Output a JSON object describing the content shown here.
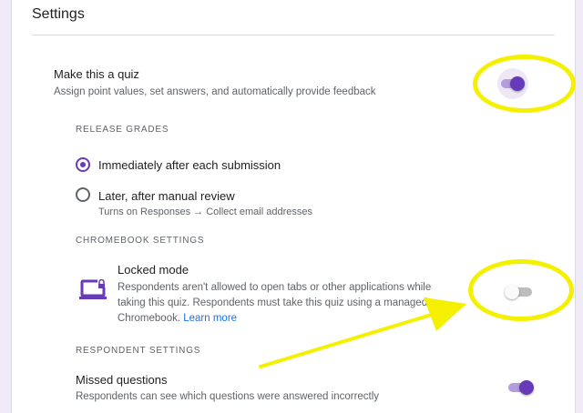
{
  "settings": {
    "title": "Settings"
  },
  "quiz": {
    "label": "Make this a quiz",
    "desc": "Assign point values, set answers, and automatically provide feedback",
    "toggle_on": true
  },
  "release_grades": {
    "heading": "RELEASE GRADES",
    "options": [
      {
        "label": "Immediately after each submission",
        "checked": true
      },
      {
        "label": "Later, after manual review",
        "desc": "Turns on Responses → Collect email addresses",
        "checked": false
      }
    ]
  },
  "chromebook": {
    "heading": "CHROMEBOOK SETTINGS",
    "locked_mode": {
      "label": "Locked mode",
      "desc_line1": "Respondents aren't allowed to open tabs or other applications while",
      "desc_line2": "taking this quiz. Respondents must take this quiz using a managed",
      "desc_line3": "Chromebook.",
      "link": "Learn more",
      "toggle_on": false
    }
  },
  "respondent": {
    "heading": "RESPONDENT SETTINGS",
    "missed": {
      "label": "Missed questions",
      "desc": "Respondents can see which questions were answered incorrectly",
      "toggle_on": true
    }
  },
  "colors": {
    "accent": "#673ab7",
    "highlight": "#f5f000",
    "link": "#1a73e8"
  },
  "icons": {
    "locked_mode": "laptop-lock-icon"
  }
}
